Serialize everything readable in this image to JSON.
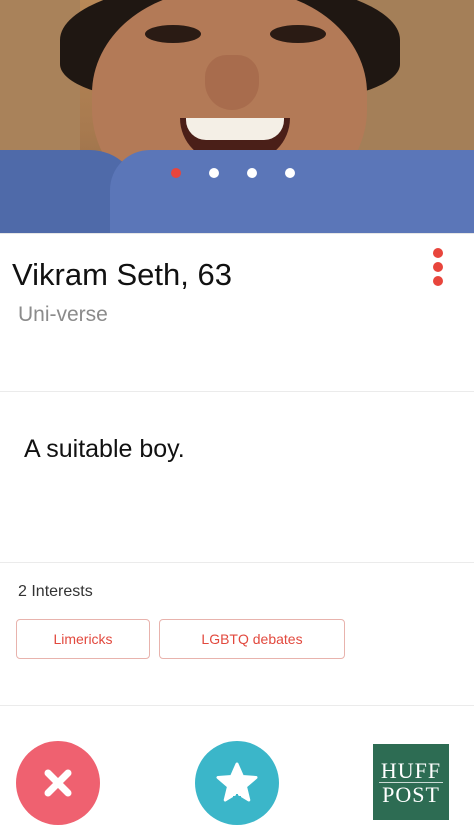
{
  "profile": {
    "name_age": "Vikram Seth, 63",
    "subtitle": "Uni-verse",
    "bio": "A suitable boy."
  },
  "photo": {
    "dots_total": 4,
    "active_index": 0,
    "accent_color": "#e8453c"
  },
  "interests": {
    "title": "2 Interests",
    "items": [
      "Limericks",
      "LGBTQ debates"
    ]
  },
  "actions": {
    "nope_icon": "close-icon",
    "super_icon": "star-icon",
    "nope_color": "#ef6170",
    "super_color": "#3bb6c9"
  },
  "brand": {
    "line1": "HUFF",
    "line2": "POST",
    "color": "#2d6c53"
  }
}
